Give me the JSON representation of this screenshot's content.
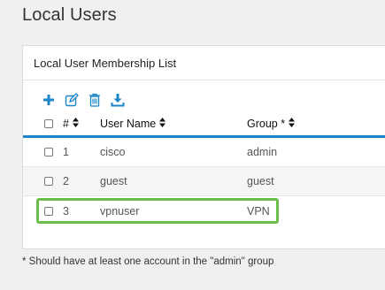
{
  "page": {
    "title": "Local Users"
  },
  "panel": {
    "title": "Local User Membership List"
  },
  "toolbar": {
    "icons": [
      "add-icon",
      "edit-icon",
      "delete-icon",
      "download-icon"
    ],
    "accent": "#1b85c7"
  },
  "table": {
    "columns": {
      "num": "#",
      "user": "User Name",
      "group": "Group *"
    },
    "rows": [
      {
        "num": "1",
        "user": "cisco",
        "group": "admin"
      },
      {
        "num": "2",
        "user": "guest",
        "group": "guest"
      },
      {
        "num": "3",
        "user": "vpnuser",
        "group": "VPN"
      }
    ],
    "highlighted_row": "3",
    "highlight_color": "#6abf4b"
  },
  "footnote": "* Should have at least one account in the \"admin\" group"
}
